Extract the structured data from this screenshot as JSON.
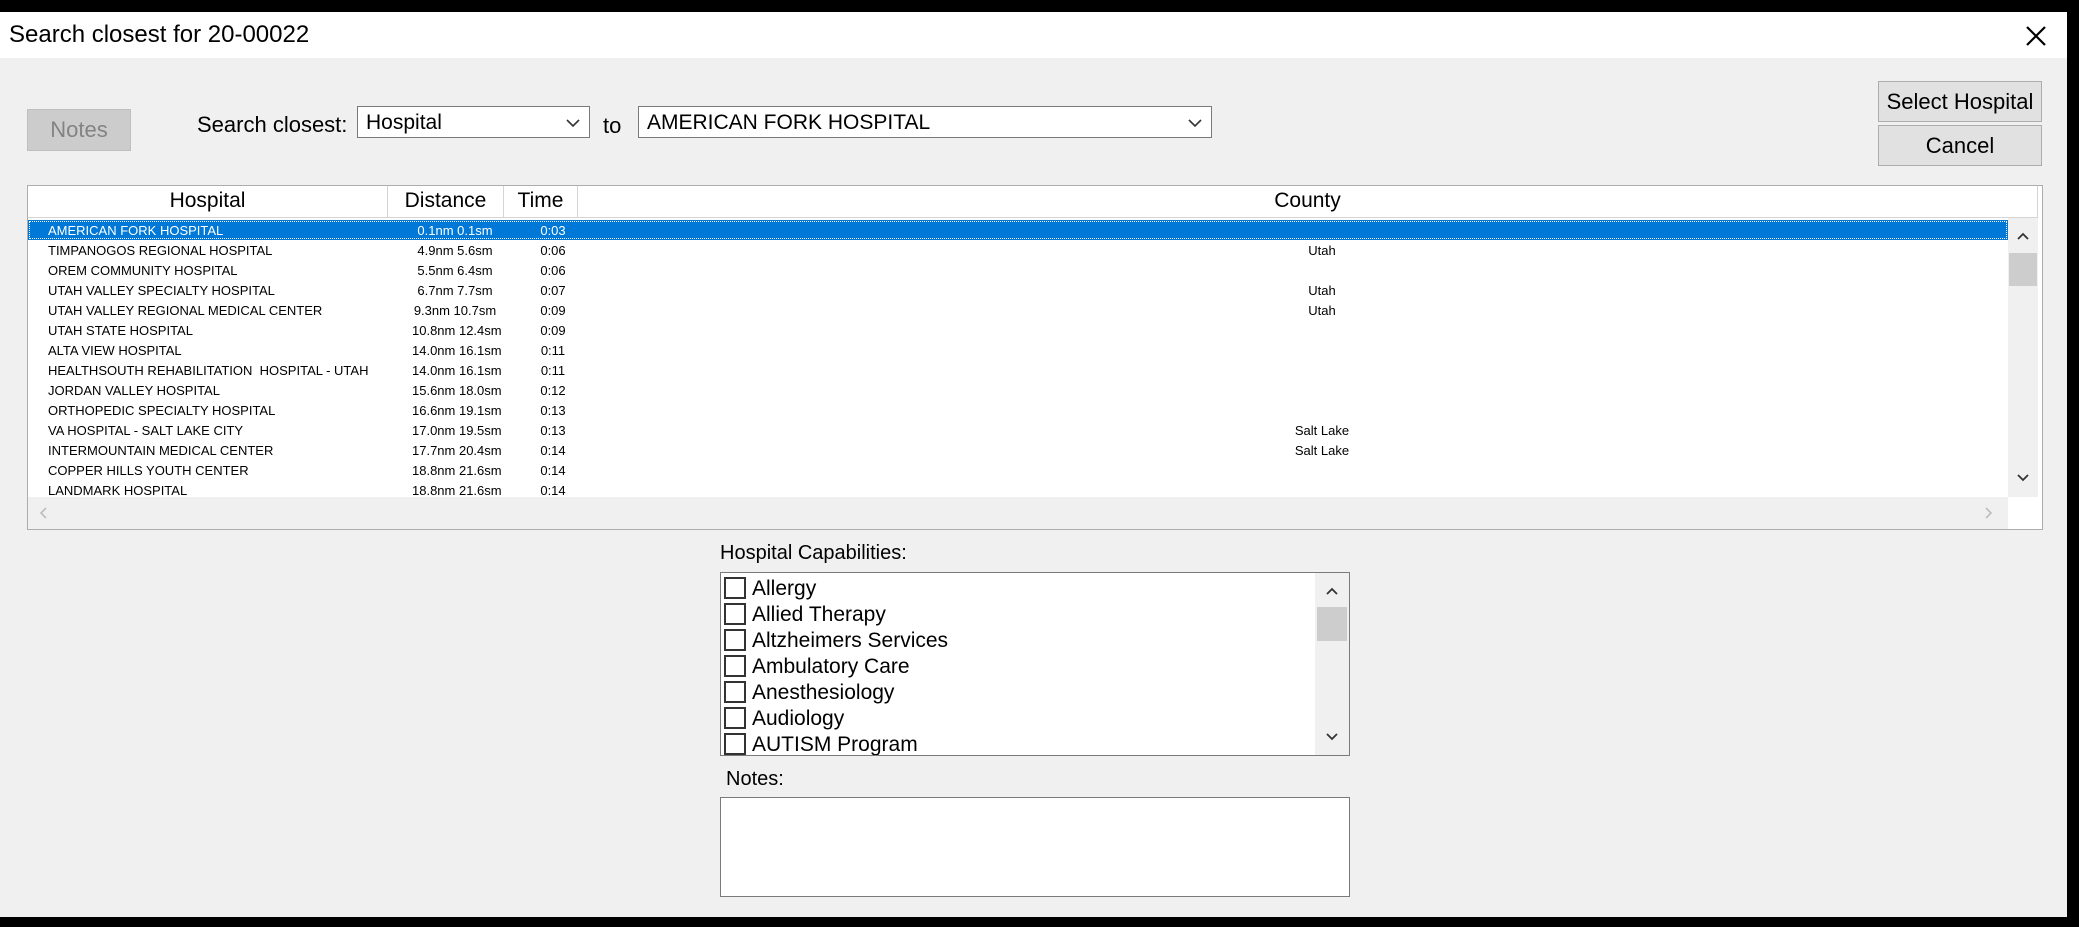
{
  "window": {
    "title": "Search closest for 20-00022"
  },
  "toolbar": {
    "notes_button": "Notes",
    "search_label": "Search closest:",
    "type_value": "Hospital",
    "to_label": "to",
    "target_value": "AMERICAN FORK HOSPITAL",
    "select_button": "Select Hospital",
    "cancel_button": "Cancel"
  },
  "table": {
    "columns": [
      "Hospital",
      "Distance",
      "Time",
      "County"
    ],
    "rows": [
      {
        "hospital": "AMERICAN FORK HOSPITAL",
        "distance": "0.1nm 0.1sm",
        "time": "0:03",
        "county": ""
      },
      {
        "hospital": "TIMPANOGOS REGIONAL HOSPITAL",
        "distance": "4.9nm 5.6sm",
        "time": "0:06",
        "county": "Utah"
      },
      {
        "hospital": "OREM COMMUNITY HOSPITAL",
        "distance": "5.5nm 6.4sm",
        "time": "0:06",
        "county": ""
      },
      {
        "hospital": "UTAH VALLEY SPECIALTY HOSPITAL",
        "distance": "6.7nm 7.7sm",
        "time": "0:07",
        "county": "Utah"
      },
      {
        "hospital": "UTAH VALLEY REGIONAL MEDICAL CENTER",
        "distance": "9.3nm 10.7sm",
        "time": "0:09",
        "county": "Utah"
      },
      {
        "hospital": "UTAH STATE HOSPITAL",
        "distance": "10.8nm 12.4sm",
        "time": "0:09",
        "county": ""
      },
      {
        "hospital": "ALTA VIEW HOSPITAL",
        "distance": "14.0nm 16.1sm",
        "time": "0:11",
        "county": ""
      },
      {
        "hospital": "HEALTHSOUTH REHABILITATION  HOSPITAL - UTAH",
        "distance": "14.0nm 16.1sm",
        "time": "0:11",
        "county": ""
      },
      {
        "hospital": "JORDAN VALLEY HOSPITAL",
        "distance": "15.6nm 18.0sm",
        "time": "0:12",
        "county": ""
      },
      {
        "hospital": "ORTHOPEDIC SPECIALTY HOSPITAL",
        "distance": "16.6nm 19.1sm",
        "time": "0:13",
        "county": ""
      },
      {
        "hospital": "VA HOSPITAL - SALT LAKE CITY",
        "distance": "17.0nm 19.5sm",
        "time": "0:13",
        "county": "Salt Lake"
      },
      {
        "hospital": "INTERMOUNTAIN MEDICAL CENTER",
        "distance": "17.7nm 20.4sm",
        "time": "0:14",
        "county": "Salt Lake"
      },
      {
        "hospital": "COPPER HILLS YOUTH CENTER",
        "distance": "18.8nm 21.6sm",
        "time": "0:14",
        "county": ""
      },
      {
        "hospital": "LANDMARK HOSPITAL",
        "distance": "18.8nm 21.6sm",
        "time": "0:14",
        "county": ""
      }
    ]
  },
  "capabilities": {
    "label": "Hospital Capabilities:",
    "items": [
      "Allergy",
      "Allied Therapy",
      "Altzheimers Services",
      "Ambulatory Care",
      "Anesthesiology",
      "Audiology",
      "AUTISM Program"
    ]
  },
  "notes": {
    "label": "Notes:",
    "value": ""
  },
  "colors": {
    "selection": "#0078d7",
    "window_bg": "#f0f0f0"
  }
}
